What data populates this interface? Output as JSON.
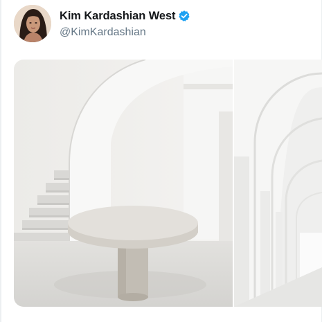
{
  "tweet": {
    "author": {
      "display_name": "Kim Kardashian West",
      "handle": "@KimKardashian",
      "verified": true,
      "avatar_icon": "profile-photo"
    },
    "media": [
      {
        "kind": "photo",
        "icon": "white-staircase-round-table-photo"
      },
      {
        "kind": "photo",
        "icon": "white-arched-hallway-photo"
      }
    ]
  },
  "colors": {
    "verified_badge": "#1da1f2",
    "name_text": "#14171a",
    "handle_text": "#657786"
  }
}
